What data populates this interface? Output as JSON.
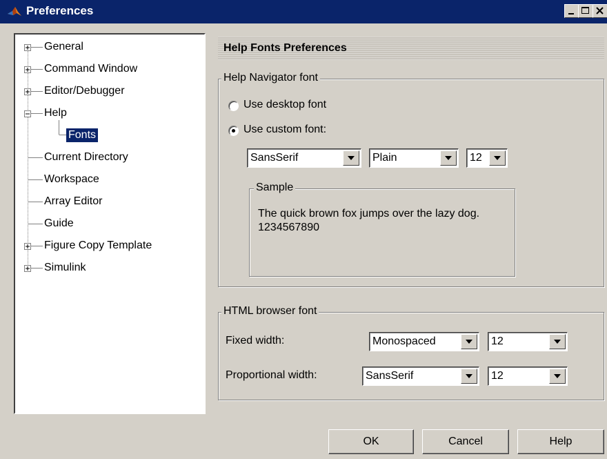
{
  "window": {
    "title": "Preferences"
  },
  "tree": {
    "items": [
      {
        "label": "General",
        "expander": "plus"
      },
      {
        "label": "Command Window",
        "expander": "plus"
      },
      {
        "label": "Editor/Debugger",
        "expander": "plus"
      },
      {
        "label": "Help",
        "expander": "minus"
      },
      {
        "label": "Fonts",
        "expander": "none",
        "child": true,
        "selected": true
      },
      {
        "label": "Current Directory",
        "expander": "none"
      },
      {
        "label": "Workspace",
        "expander": "none"
      },
      {
        "label": "Array Editor",
        "expander": "none"
      },
      {
        "label": "Guide",
        "expander": "none"
      },
      {
        "label": "Figure Copy Template",
        "expander": "plus"
      },
      {
        "label": "Simulink",
        "expander": "plus"
      }
    ]
  },
  "panel": {
    "header": "Help Fonts Preferences",
    "navigator": {
      "legend": "Help Navigator font",
      "desktop_radio": "Use desktop font",
      "custom_radio": "Use custom font:",
      "selected": "custom",
      "font_name": "SansSerif",
      "font_style": "Plain",
      "font_size": "12",
      "sample_legend": "Sample",
      "sample_text": "The quick brown fox jumps over the lazy dog. 1234567890"
    },
    "html": {
      "legend": "HTML browser font",
      "fixed_label": "Fixed width:",
      "fixed_font": "Monospaced",
      "fixed_size": "12",
      "proportional_label": "Proportional width:",
      "proportional_font": "SansSerif",
      "proportional_size": "12"
    }
  },
  "buttons": {
    "ok": "OK",
    "cancel": "Cancel",
    "help": "Help"
  },
  "colors": {
    "titlebar": "#0a246a",
    "face": "#d4d0c8",
    "selection": "#0a246a"
  }
}
